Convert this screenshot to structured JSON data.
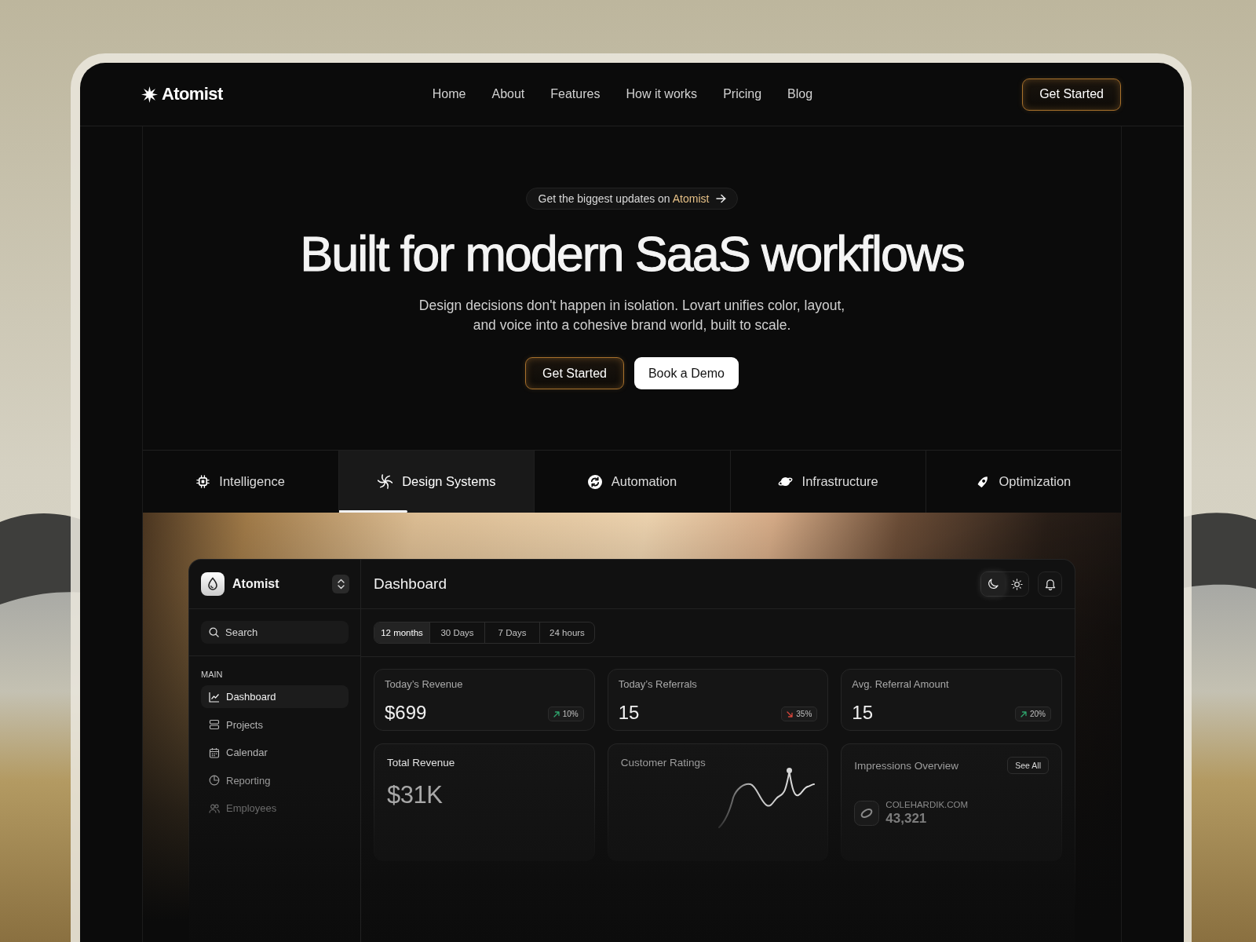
{
  "nav": {
    "logo": "Atomist",
    "links": [
      "Home",
      "About",
      "Features",
      "How it works",
      "Pricing",
      "Blog"
    ],
    "cta": "Get Started"
  },
  "hero": {
    "announcement": {
      "text": "Get the biggest updates on",
      "highlight": "Atomist"
    },
    "title": "Built for modern SaaS workflows",
    "subtitle": "Design decisions don't happen in isolation. Lovart unifies color, layout, and voice into a cohesive brand world, built to scale.",
    "buttons": [
      {
        "label": "Get Started",
        "kind": "primary"
      },
      {
        "label": "Book a Demo",
        "kind": "secondary"
      }
    ]
  },
  "tabs": [
    {
      "label": "Intelligence",
      "kind": "intelligence",
      "selected": false
    },
    {
      "label": "Design Systems",
      "kind": "design",
      "selected": true,
      "level": 0.35
    },
    {
      "label": "Automation",
      "kind": "automation",
      "selected": false
    },
    {
      "label": "Infrastructure",
      "kind": "infrastructure",
      "selected": false
    },
    {
      "label": "Optimization",
      "kind": "optimization",
      "selected": false
    }
  ],
  "dashboard": {
    "sidebar": {
      "workspace": "Atomist",
      "search": {
        "placeholder": "Search"
      },
      "section": "MAIN",
      "items": [
        {
          "label": "Dashboard",
          "kind": "dashboard",
          "selected": true
        },
        {
          "label": "Projects",
          "kind": "projects",
          "selected": false
        },
        {
          "label": "Calendar",
          "kind": "calendar",
          "selected": false
        },
        {
          "label": "Reporting",
          "kind": "reporting",
          "selected": false
        },
        {
          "label": "Employees",
          "kind": "employees",
          "selected": false
        }
      ]
    },
    "title": "Dashboard",
    "theme": [
      {
        "kind": "dark",
        "selected": true
      },
      {
        "kind": "light",
        "selected": false
      }
    ],
    "periods": [
      {
        "label": "12 months",
        "selected": true
      },
      {
        "label": "30 Days",
        "selected": false
      },
      {
        "label": "7 Days",
        "selected": false
      },
      {
        "label": "24 hours",
        "selected": false
      }
    ],
    "stats": [
      {
        "label": "Today’s Revenue",
        "value": "$699",
        "kind": "up",
        "change": "10%"
      },
      {
        "label": "Today’s Referrals",
        "value": "15",
        "kind": "down",
        "change": "35%"
      },
      {
        "label": "Avg. Referral Amount",
        "value": "15",
        "kind": "up",
        "change": "20%"
      }
    ],
    "panels": [
      {
        "kind": "revenue",
        "title": "Total Revenue",
        "value": "$31K"
      },
      {
        "kind": "ratings",
        "title": "Customer Ratings"
      },
      {
        "kind": "impressions",
        "title": "Impressions Overview",
        "action": "See All",
        "site": "COLEHARDIK.COM",
        "value": "43,321"
      }
    ]
  }
}
